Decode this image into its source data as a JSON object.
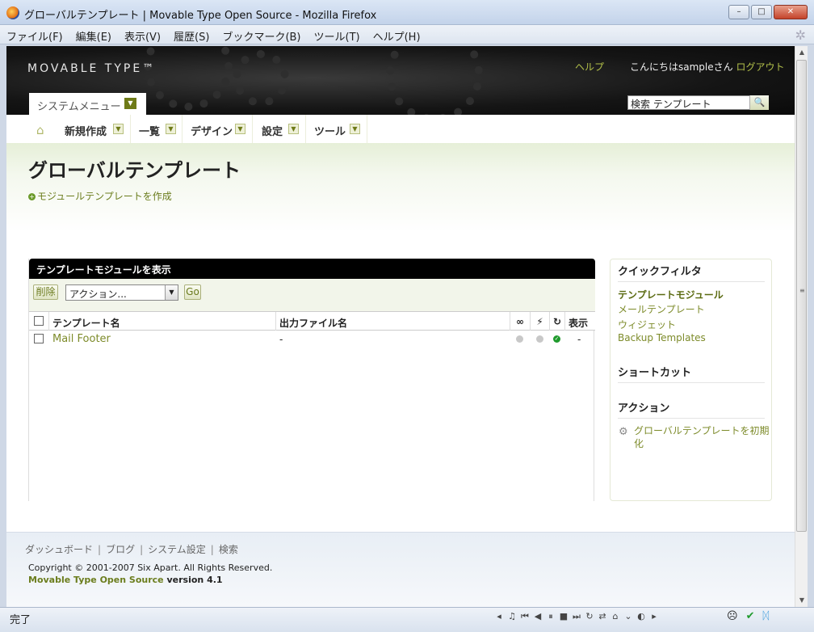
{
  "window": {
    "title": "グローバルテンプレート | Movable Type Open Source - Mozilla Firefox",
    "minimize": "–",
    "maximize": "□",
    "close": "✕"
  },
  "menubar": {
    "items": [
      "ファイル(F)",
      "編集(E)",
      "表示(V)",
      "履歴(S)",
      "ブックマーク(B)",
      "ツール(T)",
      "ヘルプ(H)"
    ]
  },
  "header": {
    "logo": "MOVABLE TYPE™",
    "help": "ヘルプ",
    "greeting": "こんにちはsampleさん",
    "logout": "ログアウト",
    "system_menu": "システムメニュー",
    "search_value": "検索 テンプレート"
  },
  "nav": {
    "items": [
      "新規作成",
      "一覧",
      "デザイン",
      "設定",
      "ツール"
    ]
  },
  "page": {
    "title": "グローバルテンプレート",
    "create_link": "モジュールテンプレートを作成"
  },
  "panel": {
    "header": "テンプレートモジュールを表示",
    "delete_button": "削除",
    "action_select": "アクション...",
    "go_button": "Go",
    "columns": {
      "name": "テンプレート名",
      "output": "出力ファイル名",
      "display": "表示"
    },
    "rows": [
      {
        "name": "Mail Footer",
        "output": "-",
        "display": "-"
      }
    ]
  },
  "sidebar": {
    "quick_filter_title": "クイックフィルタ",
    "filters": [
      "テンプレートモジュール",
      "メールテンプレート",
      "ウィジェット",
      "Backup Templates"
    ],
    "shortcut_title": "ショートカット",
    "action_title": "アクション",
    "action_link_line1": "グローバルテンプレートを初期",
    "action_link_line2": "化"
  },
  "footer": {
    "links": [
      "ダッシュボード",
      "ブログ",
      "システム設定",
      "検索"
    ],
    "copyright": "Copyright © 2001-2007 Six Apart. All Rights Reserved.",
    "product": "Movable Type Open Source",
    "version": "version 4.1"
  },
  "statusbar": {
    "text": "完了"
  },
  "colors": {
    "accent": "#6b7d1d",
    "header_bg": "#111111",
    "link": "#b3c14a"
  }
}
